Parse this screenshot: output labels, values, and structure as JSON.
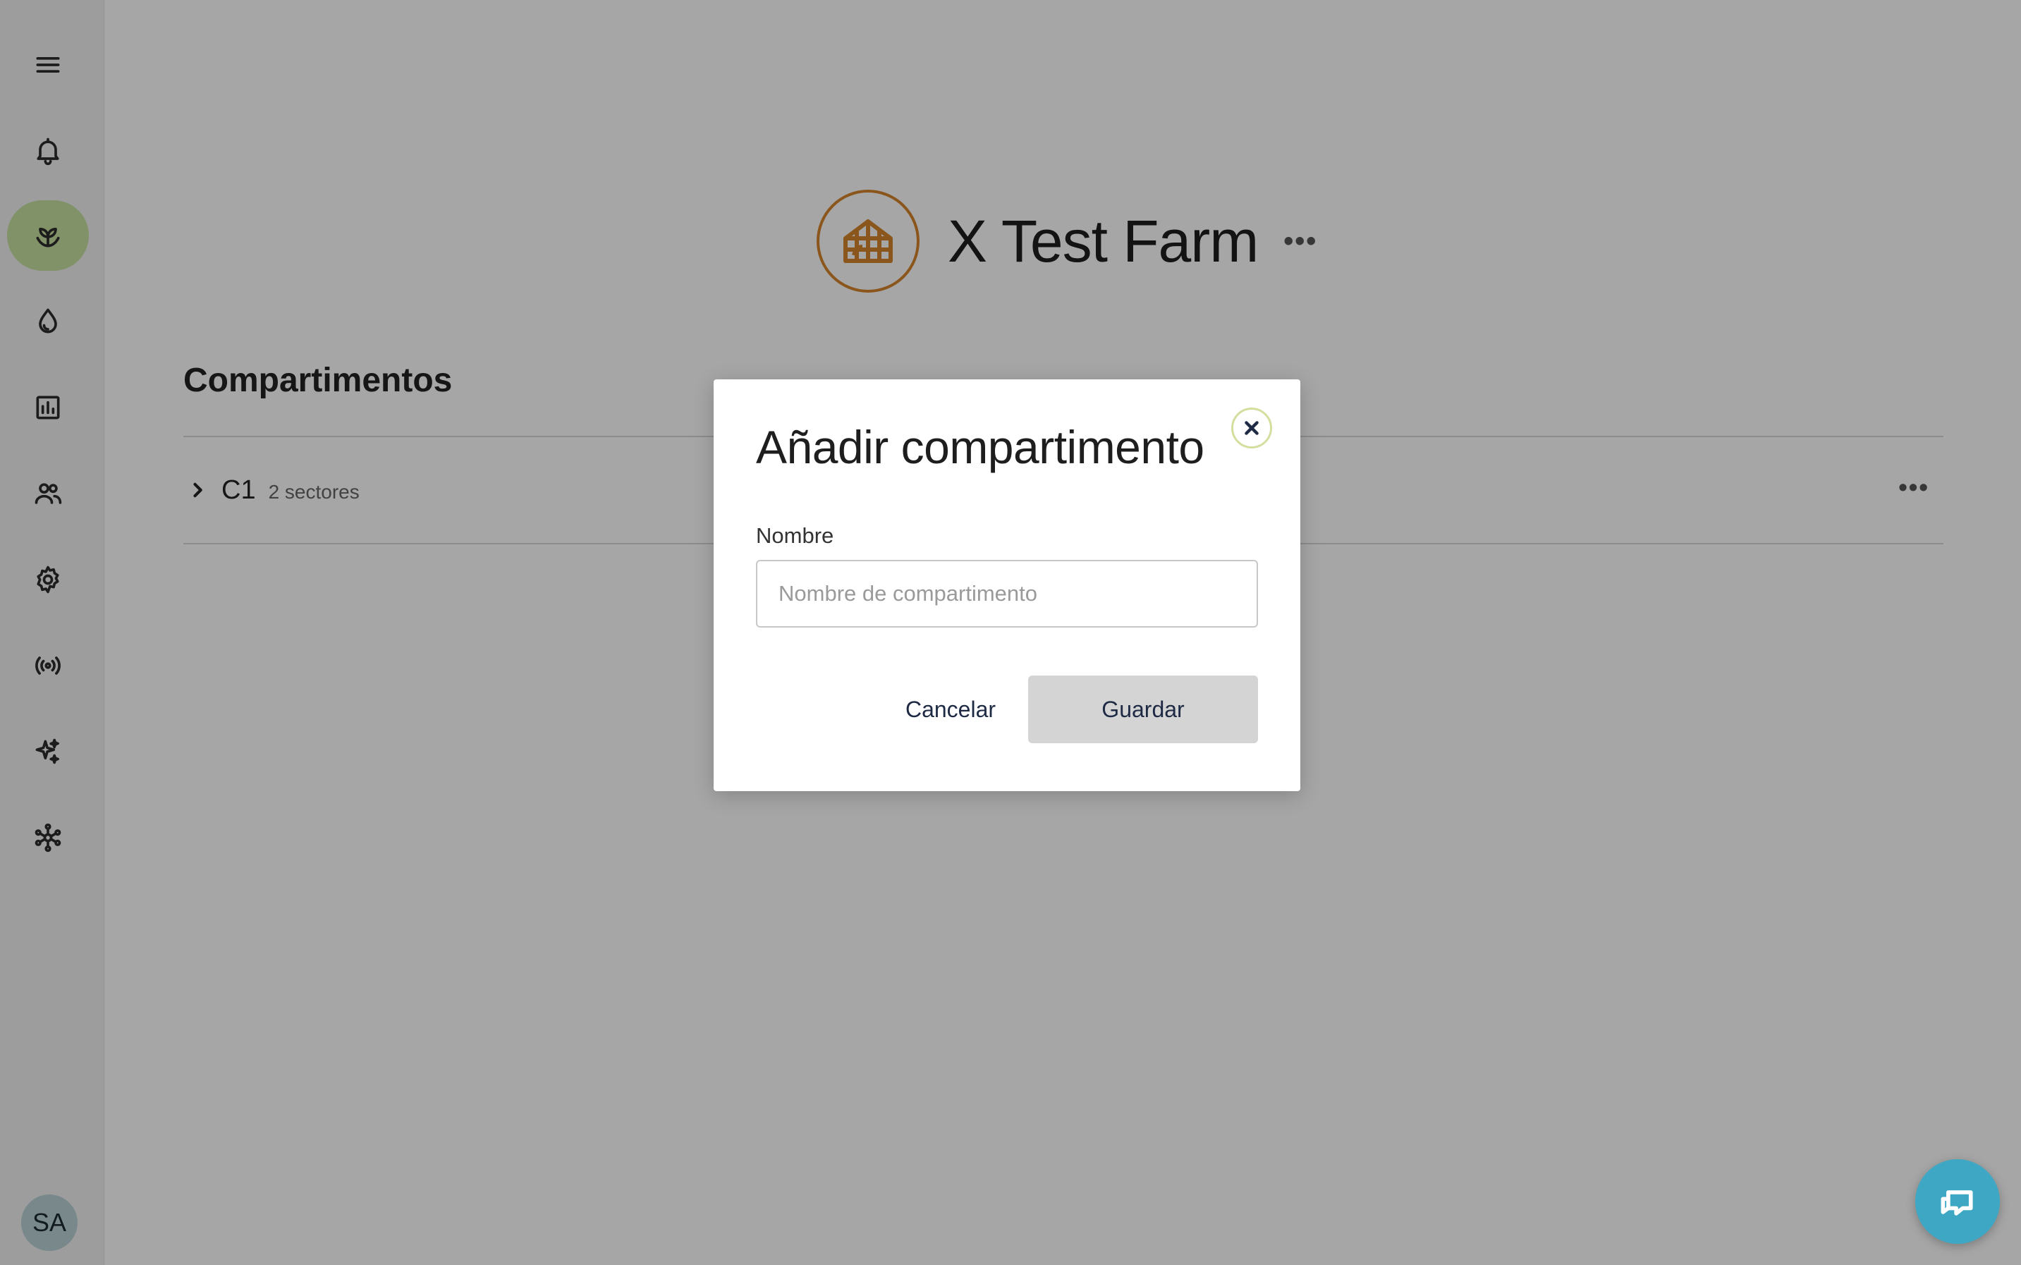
{
  "sidebar": {
    "items": [
      {
        "icon": "menu-icon"
      },
      {
        "icon": "bell-icon"
      },
      {
        "icon": "sprout-icon",
        "active": true
      },
      {
        "icon": "water-drop-icon"
      },
      {
        "icon": "bar-chart-icon"
      },
      {
        "icon": "users-icon"
      },
      {
        "icon": "gear-icon"
      },
      {
        "icon": "broadcast-icon"
      },
      {
        "icon": "sparkles-icon"
      },
      {
        "icon": "network-icon"
      }
    ],
    "avatar_initials": "SA",
    "active_color": "#c6e0a0"
  },
  "farm": {
    "name": "X Test Farm",
    "more": "•••",
    "logo_icon": "greenhouse-icon",
    "logo_color": "#d6852c"
  },
  "section": {
    "title": "Compartimentos",
    "rows": [
      {
        "name": "C1",
        "subtitle": "2 sectores",
        "more": "•••"
      }
    ]
  },
  "dialog": {
    "title": "Añadir compartimento",
    "field_label": "Nombre",
    "field_placeholder": "Nombre de compartimento",
    "field_value": "",
    "cancel_label": "Cancelar",
    "save_label": "Guardar"
  },
  "chat": {
    "icon": "chat-icon",
    "color": "#3ea8c4"
  }
}
